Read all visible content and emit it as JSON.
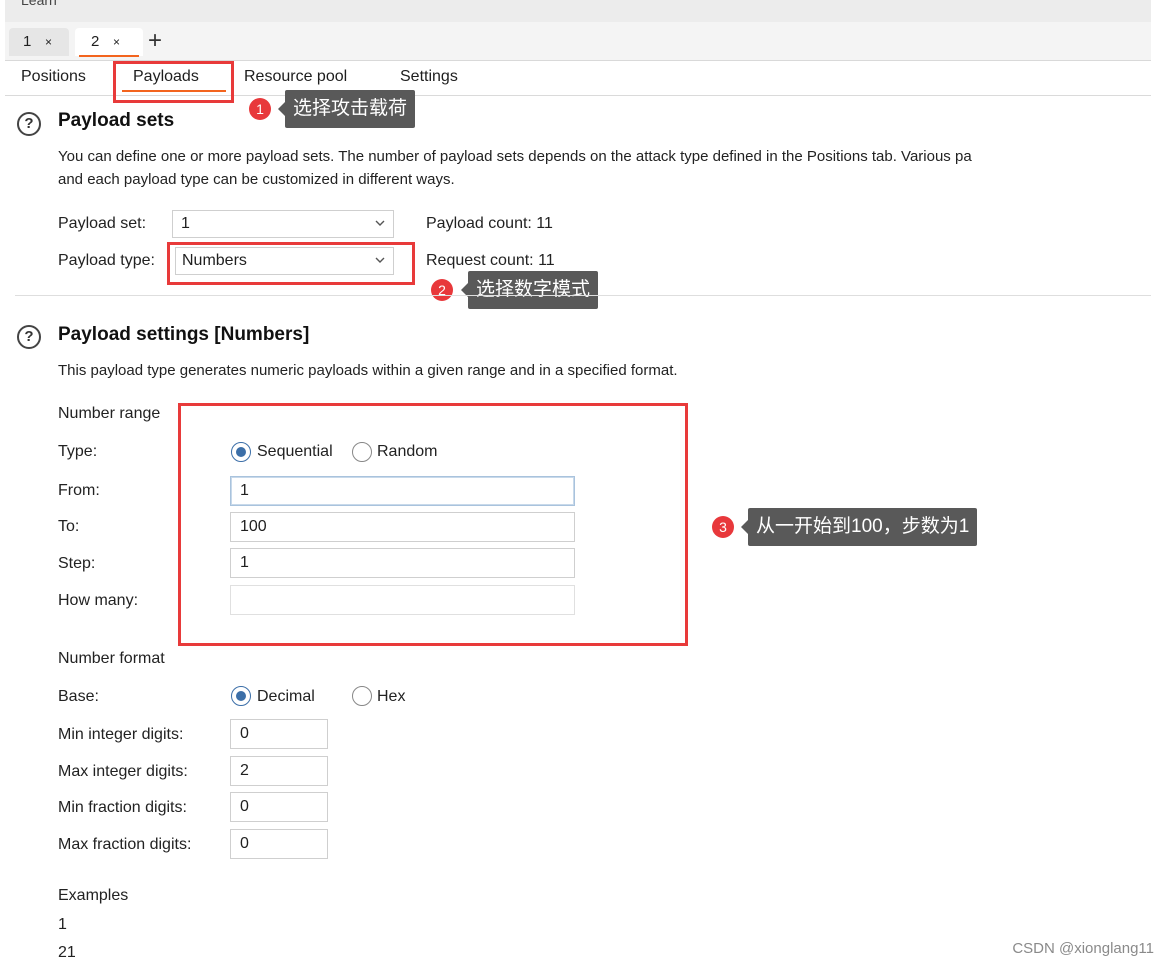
{
  "window": {
    "learn_label": "Learn"
  },
  "tabs": [
    {
      "num": "1",
      "close": "×"
    },
    {
      "num": "2",
      "close": "×"
    }
  ],
  "new_tab": "+",
  "subtabs": [
    "Positions",
    "Payloads",
    "Resource pool",
    "Settings"
  ],
  "annotations": {
    "a1": {
      "num": "1",
      "text": "选择攻击载荷"
    },
    "a2": {
      "num": "2",
      "text": "选择数字模式"
    },
    "a3": {
      "num": "3",
      "text": "从一开始到100，步数为1"
    },
    "highlight_color": "#e83a3a"
  },
  "payload_sets": {
    "help_glyph": "?",
    "title": "Payload sets",
    "desc_line1": "You can define one or more payload sets. The number of payload sets depends on the attack type defined in the Positions tab. Various pa",
    "desc_line2": "and each payload type can be customized in different ways.",
    "set_label": "Payload set:",
    "set_value": "1",
    "type_label": "Payload type:",
    "type_value": "Numbers",
    "payload_count": "Payload count: 11",
    "request_count": "Request count: 11"
  },
  "payload_settings": {
    "help_glyph": "?",
    "title": "Payload settings [Numbers]",
    "desc": "This payload type generates numeric payloads within a given range and in a specified format.",
    "number_range_label": "Number range",
    "type_label": "Type:",
    "type_options": [
      "Sequential",
      "Random"
    ],
    "type_selected": "Sequential",
    "from_label": "From:",
    "from_value": "1",
    "to_label": "To:",
    "to_value": "100",
    "step_label": "Step:",
    "step_value": "1",
    "how_many_label": "How many:",
    "how_many_value": "",
    "number_format_label": "Number format",
    "base_label": "Base:",
    "base_options": [
      "Decimal",
      "Hex"
    ],
    "base_selected": "Decimal",
    "min_int_label": "Min integer digits:",
    "min_int_value": "0",
    "max_int_label": "Max integer digits:",
    "max_int_value": "2",
    "min_frac_label": "Min fraction digits:",
    "min_frac_value": "0",
    "max_frac_label": "Max fraction digits:",
    "max_frac_value": "0",
    "examples_label": "Examples",
    "examples": [
      "1",
      "21"
    ]
  },
  "watermark": "CSDN @xionglang11",
  "colors": {
    "accent": "#f3641e",
    "radio": "#3c6fa8",
    "annotation_bg": "#595959"
  }
}
